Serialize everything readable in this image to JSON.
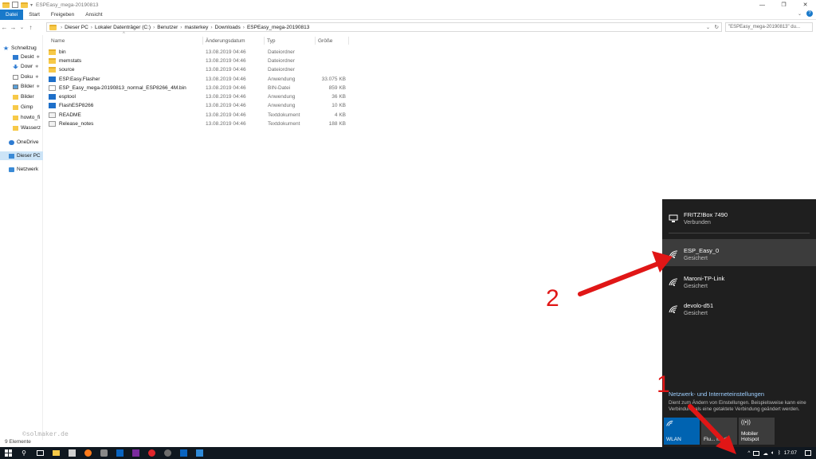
{
  "window": {
    "title": "ESPEasy_mega-20190813",
    "controls": [
      "—",
      "❐",
      "✕"
    ]
  },
  "ribbon": {
    "tabs": [
      "Datei",
      "Start",
      "Freigeben",
      "Ansicht"
    ],
    "help": "?"
  },
  "address": {
    "segments": [
      "Dieser PC",
      "Lokaler Datenträger (C:)",
      "Benutzer",
      "masterkey",
      "Downloads",
      "ESPEasy_mega-20190813"
    ],
    "search_placeholder": "\"ESPEasy_mega-20190813\" du..."
  },
  "navpane": {
    "items": [
      {
        "label": "Schnellzug",
        "icon": "star-icon"
      },
      {
        "label": "Deskt",
        "icon": "desktop-icon"
      },
      {
        "label": "Dowr",
        "icon": "download-icon"
      },
      {
        "label": "Doku",
        "icon": "document-icon"
      },
      {
        "label": "Bilder",
        "icon": "pictures-icon"
      },
      {
        "label": "Bilder",
        "icon": "folder-icon"
      },
      {
        "label": "Gimp",
        "icon": "folder-icon"
      },
      {
        "label": "howto_fi",
        "icon": "folder-icon"
      },
      {
        "label": "Wasserz",
        "icon": "folder-icon"
      },
      {
        "label": "OneDrive",
        "icon": "cloud-icon"
      },
      {
        "label": "Dieser PC",
        "icon": "pc-icon"
      },
      {
        "label": "Netzwerk",
        "icon": "network-icon"
      }
    ]
  },
  "filelist": {
    "columns": [
      "Name",
      "Änderungsdatum",
      "Typ",
      "Größe"
    ],
    "rows": [
      {
        "name": "bin",
        "date": "13.08.2019 04:46",
        "type": "Dateiordner",
        "size": "",
        "icon": "folder"
      },
      {
        "name": "memstats",
        "date": "13.08.2019 04:46",
        "type": "Dateiordner",
        "size": "",
        "icon": "folder"
      },
      {
        "name": "source",
        "date": "13.08.2019 04:46",
        "type": "Dateiordner",
        "size": "",
        "icon": "folder"
      },
      {
        "name": "ESP.Easy.Flasher",
        "date": "13.08.2019 04:46",
        "type": "Anwendung",
        "size": "33.075 KB",
        "icon": "app"
      },
      {
        "name": "ESP_Easy_mega-20190813_normal_ESP8266_4M.bin",
        "date": "13.08.2019 04:46",
        "type": "BIN-Datei",
        "size": "859 KB",
        "icon": "file"
      },
      {
        "name": "esptool",
        "date": "13.08.2019 04:46",
        "type": "Anwendung",
        "size": "36 KB",
        "icon": "app"
      },
      {
        "name": "FlashESP8266",
        "date": "13.08.2019 04:46",
        "type": "Anwendung",
        "size": "10 KB",
        "icon": "app"
      },
      {
        "name": "README",
        "date": "13.08.2019 04:46",
        "type": "Textdokument",
        "size": "4 KB",
        "icon": "txt"
      },
      {
        "name": "Release_notes",
        "date": "13.08.2019 04:46",
        "type": "Textdokument",
        "size": "188 KB",
        "icon": "txt"
      }
    ]
  },
  "status": {
    "items": "9 Elemente"
  },
  "watermark": "©solmaker.de",
  "flyout": {
    "networks": [
      {
        "name": "FRITZ!Box 7490",
        "status": "Verbunden",
        "icon": "ethernet-icon"
      },
      {
        "name": "ESP_Easy_0",
        "status": "Gesichert",
        "icon": "wifi-icon"
      },
      {
        "name": "Maroni-TP-Link",
        "status": "Gesichert",
        "icon": "wifi-icon"
      },
      {
        "name": "devolo-d51",
        "status": "Gesichert",
        "icon": "wifi-icon"
      }
    ],
    "settings_link": "Netzwerk- und Interneteinstellungen",
    "settings_desc": "Dient zum Ändern von Einstellungen. Beispielsweise kann eine Verbindung als eine getaktete Verbindung geändert werden.",
    "tiles": [
      {
        "label": "WLAN",
        "color": "#0063b1"
      },
      {
        "label": "Flu... modi",
        "color": "#3c3c3c"
      },
      {
        "label": "Mobiler Hotspot",
        "color": "#3c3c3c"
      }
    ]
  },
  "taskbar": {
    "time": "17:07"
  },
  "annotations": {
    "one": "1",
    "two": "2",
    "color": "#e01616"
  }
}
